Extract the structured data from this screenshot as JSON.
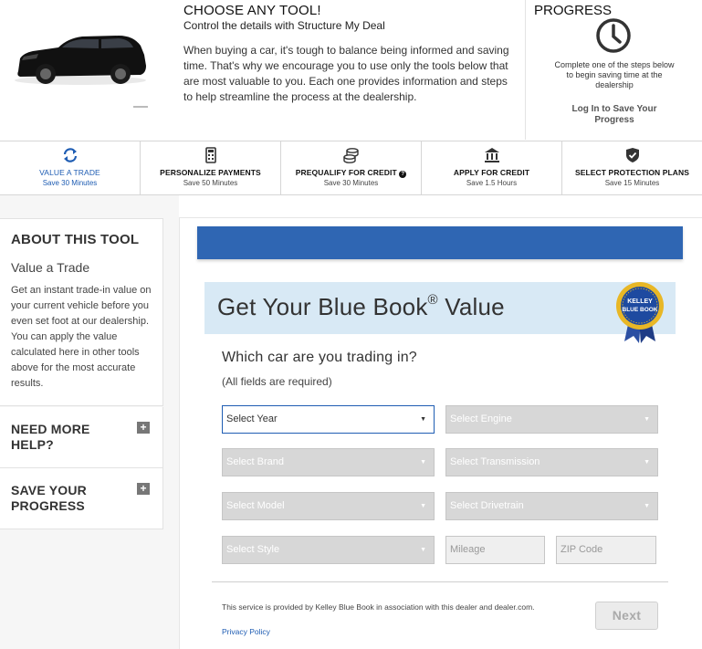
{
  "header": {
    "title": "CHOOSE ANY TOOL!",
    "subtitle": "Control the details with Structure My Deal",
    "body": "When buying a car, it's tough to balance being informed and saving time. That's why we encourage you to use only the tools below that are most valuable to you. Each one provides information and steps to help streamline the process at the dealership.",
    "car_image": "black-suv"
  },
  "progress": {
    "title": "PROGRESS",
    "icon": "clock-icon",
    "note": "Complete one of the steps below to begin saving time at the dealership",
    "login_label": "Log In to Save Your Progress"
  },
  "tabs": [
    {
      "label": "VALUE A TRADE",
      "time": "Save 30 Minutes",
      "icon": "refresh-icon",
      "active": true
    },
    {
      "label": "PERSONALIZE PAYMENTS",
      "time": "Save 50 Minutes",
      "icon": "calculator-icon",
      "active": false
    },
    {
      "label": "PREQUALIFY FOR CREDIT",
      "time": "Save 30 Minutes",
      "icon": "coins-icon",
      "active": false,
      "info_icon": "help-circle-icon"
    },
    {
      "label": "APPLY FOR CREDIT",
      "time": "Save 1.5 Hours",
      "icon": "bank-icon",
      "active": false
    },
    {
      "label": "SELECT PROTECTION PLANS",
      "time": "Save 15 Minutes",
      "icon": "shield-check-icon",
      "active": false
    }
  ],
  "sidebar": {
    "about_title": "ABOUT THIS TOOL",
    "tool_name": "Value a Trade",
    "description": "Get an instant trade-in value on your current vehicle before you even set foot at our dealership. You can apply the value calculated here in other tools above for the most accurate results.",
    "help_title": "NEED MORE HELP?",
    "save_title": "SAVE YOUR PROGRESS",
    "expand_symbol": "+"
  },
  "main": {
    "kbb_title": "Get Your Blue Book",
    "kbb_reg": "®",
    "kbb_title_suffix": " Value",
    "badge": {
      "top": "KELLEY",
      "bottom": "BLUE BOOK",
      "icon": "kelley-blue-book-badge"
    },
    "question": "Which car are you trading in?",
    "required_note": "(All fields are required)",
    "fields": {
      "year": "Select Year",
      "brand": "Select Brand",
      "model": "Select Model",
      "style": "Select Style",
      "engine": "Select Engine",
      "transmission": "Select Transmission",
      "drivetrain": "Select Drivetrain",
      "mileage_placeholder": "Mileage",
      "zip_placeholder": "ZIP Code"
    },
    "caret": "▼",
    "footer_text": "This service is provided by Kelley Blue Book in association with this dealer and dealer.com.",
    "privacy_label": "Privacy Policy",
    "next_label": "Next"
  },
  "colors": {
    "accent": "#1f5db3",
    "bar": "#2f66b3",
    "kbb_bg": "#d8e9f5",
    "disabled": "#d7d7d7"
  }
}
